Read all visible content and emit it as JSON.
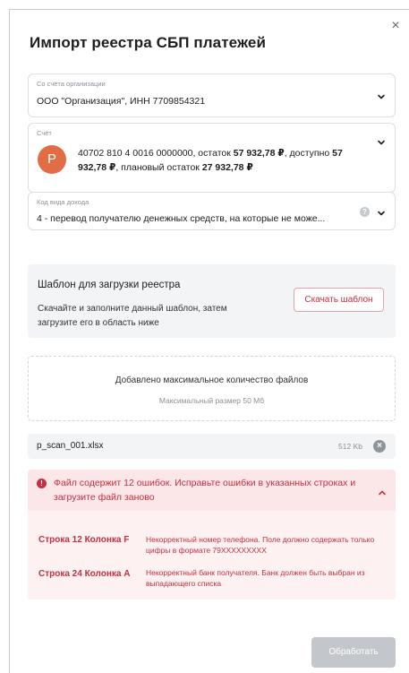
{
  "dialog": {
    "title": "Импорт реестра СБП платежей",
    "close_glyph": "×"
  },
  "account_org": {
    "label": "Со счёта организации",
    "value": "ООО \"Организация\", ИНН 7709854321"
  },
  "account": {
    "label": "Счёт",
    "avatar_letter": "P",
    "avatar_color": "#e26d45",
    "number": "40702 810 4 0016 0000000",
    "balance_prefix": ", остаток ",
    "balance": "57 932,78 ₽",
    "available_prefix": ", доступно ",
    "available": "57 932,78 ₽",
    "planned_prefix": ", плановый остаток ",
    "planned": "27 932,78 ₽"
  },
  "income_code": {
    "label": "Код вида дохода",
    "value": "4 - перевод получателю денежных средств, на которые не може...",
    "help_glyph": "?"
  },
  "template": {
    "title": "Шаблон для загрузки реестра",
    "description": "Скачайте и заполните данный шаблон, затем загрузите его в область ниже",
    "download_label": "Скачать шаблон"
  },
  "dropzone": {
    "message": "Добавлено максимальное количество файлов",
    "hint": "Максимальный размер 50 Мб"
  },
  "file": {
    "name": "p_scan_001.xlsx",
    "size": "512 Kb",
    "remove_glyph": "×"
  },
  "errors": {
    "icon_glyph": "!",
    "summary": "Файл содержит 12 ошибок. Исправьте ошибки в указанных строках и загрузите файл заново",
    "items": [
      {
        "location": "Строка 12 Колонка F",
        "message": "Некорректный номер телефона. Поле должно содержать только цифры в формате 79XXXXXXXXX"
      },
      {
        "location": "Строка 24 Колонка A",
        "message": "Некорректный банк получателя. Банк должен быть выбран из выпадающего списка"
      }
    ]
  },
  "actions": {
    "submit_label": "Обработать"
  },
  "colors": {
    "accent": "#c4303f",
    "error_bg": "#fdf1f2",
    "disabled_button": "#c3c6cb"
  }
}
